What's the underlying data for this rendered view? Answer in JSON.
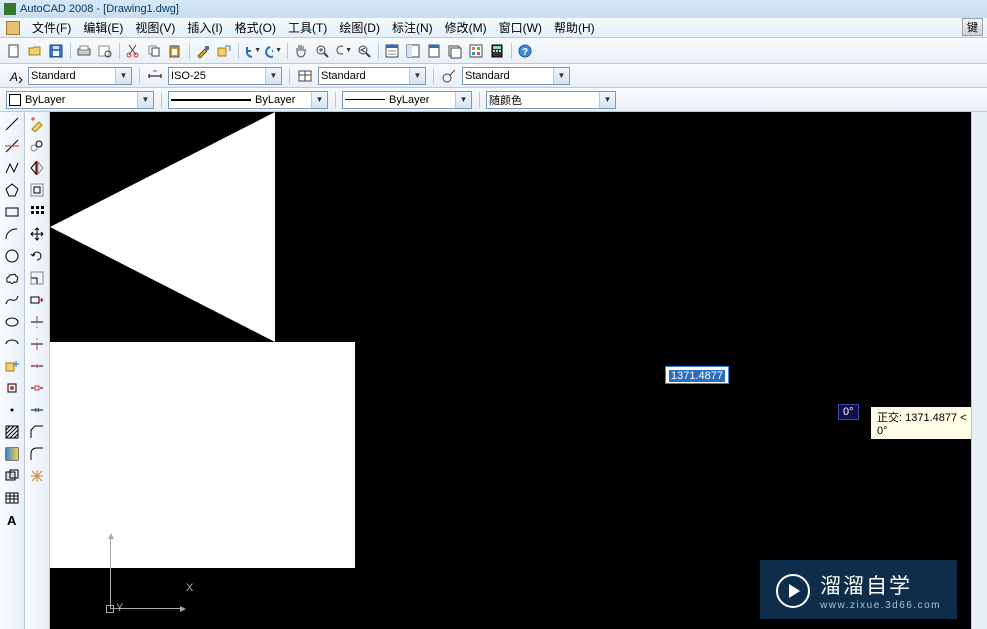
{
  "title": "AutoCAD 2008 - [Drawing1.dwg]",
  "menubar": {
    "items": [
      "文件(F)",
      "编辑(E)",
      "视图(V)",
      "插入(I)",
      "格式(O)",
      "工具(T)",
      "绘图(D)",
      "标注(N)",
      "修改(M)",
      "窗口(W)",
      "帮助(H)"
    ],
    "right_button": "键"
  },
  "styles_row": {
    "text_style": "Standard",
    "dim_style": "ISO-25",
    "table_style": "Standard",
    "mleader_style": "Standard"
  },
  "props_row": {
    "layer": "ByLayer",
    "linetype": "ByLayer",
    "lineweight": "ByLayer",
    "color": "随颜色"
  },
  "canvas": {
    "dimension_value": "1371.4877",
    "angle_value": "0°",
    "ortho_tooltip": "正交: 1371.4877 < 0°",
    "ucs_x": "X",
    "ucs_y": "Y"
  },
  "watermark": {
    "text": "溜溜自学",
    "url": "www.zixue.3d66.com"
  }
}
